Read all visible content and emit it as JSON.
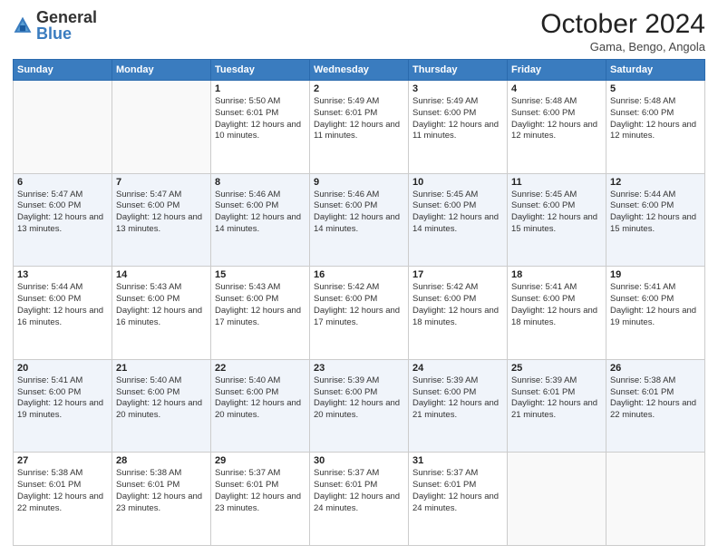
{
  "logo": {
    "general": "General",
    "blue": "Blue"
  },
  "header": {
    "month": "October 2024",
    "location": "Gama, Bengo, Angola"
  },
  "weekdays": [
    "Sunday",
    "Monday",
    "Tuesday",
    "Wednesday",
    "Thursday",
    "Friday",
    "Saturday"
  ],
  "weeks": [
    [
      {
        "day": "",
        "info": ""
      },
      {
        "day": "",
        "info": ""
      },
      {
        "day": "1",
        "info": "Sunrise: 5:50 AM\nSunset: 6:01 PM\nDaylight: 12 hours and 10 minutes."
      },
      {
        "day": "2",
        "info": "Sunrise: 5:49 AM\nSunset: 6:01 PM\nDaylight: 12 hours and 11 minutes."
      },
      {
        "day": "3",
        "info": "Sunrise: 5:49 AM\nSunset: 6:00 PM\nDaylight: 12 hours and 11 minutes."
      },
      {
        "day": "4",
        "info": "Sunrise: 5:48 AM\nSunset: 6:00 PM\nDaylight: 12 hours and 12 minutes."
      },
      {
        "day": "5",
        "info": "Sunrise: 5:48 AM\nSunset: 6:00 PM\nDaylight: 12 hours and 12 minutes."
      }
    ],
    [
      {
        "day": "6",
        "info": "Sunrise: 5:47 AM\nSunset: 6:00 PM\nDaylight: 12 hours and 13 minutes."
      },
      {
        "day": "7",
        "info": "Sunrise: 5:47 AM\nSunset: 6:00 PM\nDaylight: 12 hours and 13 minutes."
      },
      {
        "day": "8",
        "info": "Sunrise: 5:46 AM\nSunset: 6:00 PM\nDaylight: 12 hours and 14 minutes."
      },
      {
        "day": "9",
        "info": "Sunrise: 5:46 AM\nSunset: 6:00 PM\nDaylight: 12 hours and 14 minutes."
      },
      {
        "day": "10",
        "info": "Sunrise: 5:45 AM\nSunset: 6:00 PM\nDaylight: 12 hours and 14 minutes."
      },
      {
        "day": "11",
        "info": "Sunrise: 5:45 AM\nSunset: 6:00 PM\nDaylight: 12 hours and 15 minutes."
      },
      {
        "day": "12",
        "info": "Sunrise: 5:44 AM\nSunset: 6:00 PM\nDaylight: 12 hours and 15 minutes."
      }
    ],
    [
      {
        "day": "13",
        "info": "Sunrise: 5:44 AM\nSunset: 6:00 PM\nDaylight: 12 hours and 16 minutes."
      },
      {
        "day": "14",
        "info": "Sunrise: 5:43 AM\nSunset: 6:00 PM\nDaylight: 12 hours and 16 minutes."
      },
      {
        "day": "15",
        "info": "Sunrise: 5:43 AM\nSunset: 6:00 PM\nDaylight: 12 hours and 17 minutes."
      },
      {
        "day": "16",
        "info": "Sunrise: 5:42 AM\nSunset: 6:00 PM\nDaylight: 12 hours and 17 minutes."
      },
      {
        "day": "17",
        "info": "Sunrise: 5:42 AM\nSunset: 6:00 PM\nDaylight: 12 hours and 18 minutes."
      },
      {
        "day": "18",
        "info": "Sunrise: 5:41 AM\nSunset: 6:00 PM\nDaylight: 12 hours and 18 minutes."
      },
      {
        "day": "19",
        "info": "Sunrise: 5:41 AM\nSunset: 6:00 PM\nDaylight: 12 hours and 19 minutes."
      }
    ],
    [
      {
        "day": "20",
        "info": "Sunrise: 5:41 AM\nSunset: 6:00 PM\nDaylight: 12 hours and 19 minutes."
      },
      {
        "day": "21",
        "info": "Sunrise: 5:40 AM\nSunset: 6:00 PM\nDaylight: 12 hours and 20 minutes."
      },
      {
        "day": "22",
        "info": "Sunrise: 5:40 AM\nSunset: 6:00 PM\nDaylight: 12 hours and 20 minutes."
      },
      {
        "day": "23",
        "info": "Sunrise: 5:39 AM\nSunset: 6:00 PM\nDaylight: 12 hours and 20 minutes."
      },
      {
        "day": "24",
        "info": "Sunrise: 5:39 AM\nSunset: 6:00 PM\nDaylight: 12 hours and 21 minutes."
      },
      {
        "day": "25",
        "info": "Sunrise: 5:39 AM\nSunset: 6:01 PM\nDaylight: 12 hours and 21 minutes."
      },
      {
        "day": "26",
        "info": "Sunrise: 5:38 AM\nSunset: 6:01 PM\nDaylight: 12 hours and 22 minutes."
      }
    ],
    [
      {
        "day": "27",
        "info": "Sunrise: 5:38 AM\nSunset: 6:01 PM\nDaylight: 12 hours and 22 minutes."
      },
      {
        "day": "28",
        "info": "Sunrise: 5:38 AM\nSunset: 6:01 PM\nDaylight: 12 hours and 23 minutes."
      },
      {
        "day": "29",
        "info": "Sunrise: 5:37 AM\nSunset: 6:01 PM\nDaylight: 12 hours and 23 minutes."
      },
      {
        "day": "30",
        "info": "Sunrise: 5:37 AM\nSunset: 6:01 PM\nDaylight: 12 hours and 24 minutes."
      },
      {
        "day": "31",
        "info": "Sunrise: 5:37 AM\nSunset: 6:01 PM\nDaylight: 12 hours and 24 minutes."
      },
      {
        "day": "",
        "info": ""
      },
      {
        "day": "",
        "info": ""
      }
    ]
  ]
}
